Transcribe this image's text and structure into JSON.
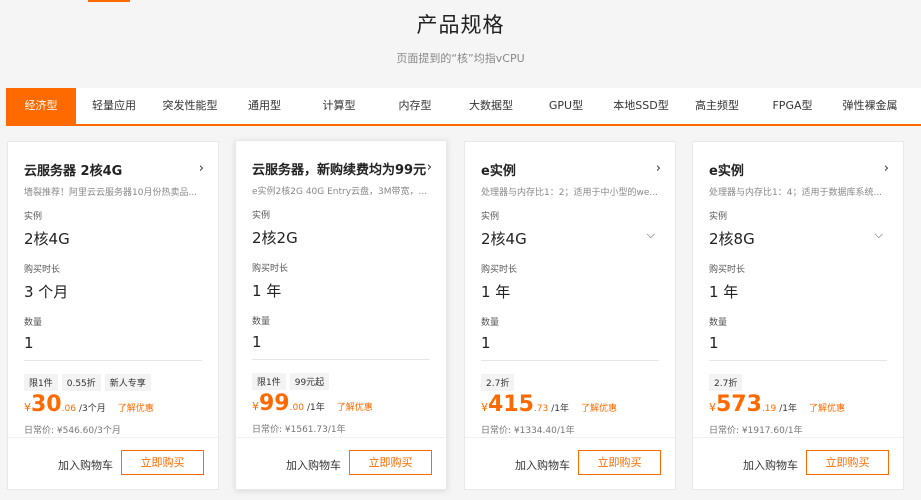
{
  "page": {
    "title": "产品规格",
    "subtitle": "页面提到的“核”均指vCPU"
  },
  "tabs": [
    "经济型",
    "轻量应用",
    "突发性能型",
    "通用型",
    "计算型",
    "内存型",
    "大数据型",
    "GPU型",
    "本地SSD型",
    "高主频型",
    "FPGA型",
    "弹性裸金属"
  ],
  "active_tab": "经济型",
  "labels": {
    "instance": "实例",
    "duration": "购买时长",
    "quantity": "数量",
    "add_to_cart": "加入购物车",
    "buy_now": "立即购买",
    "learn_promo": "了解优惠",
    "currency": "¥"
  },
  "cards": [
    {
      "title": "云服务器 2核4G",
      "desc": "墙裂推荐！阿里云云服务器10月份热卖品...",
      "instance": "2核4G",
      "duration": "3 个月",
      "quantity": "1",
      "tags": [
        "限1件",
        "0.55折",
        "新人专享"
      ],
      "price_int": "30",
      "price_dec": ".06",
      "unit": "/3个月",
      "original": "日常价: ¥546.60/3个月"
    },
    {
      "title": "云服务器，新购续费均为99元",
      "desc": "e实例2核2G 40G Entry云盘，3M带宽，...",
      "instance": "2核2G",
      "duration": "1 年",
      "quantity": "1",
      "tags": [
        "限1件",
        "99元起"
      ],
      "price_int": "99",
      "price_dec": ".00",
      "unit": "/1年",
      "original": "日常价: ¥1561.73/1年"
    },
    {
      "title": "e实例",
      "desc": "处理器与内存比1：2；适用于中小型的we...",
      "instance": "2核4G",
      "duration": "1 年",
      "quantity": "1",
      "tags": [
        "2.7折"
      ],
      "price_int": "415",
      "price_dec": ".73",
      "unit": "/1年",
      "original": "日常价: ¥1334.40/1年"
    },
    {
      "title": "e实例",
      "desc": "处理器与内存比1：4；适用于数据库系统...",
      "instance": "2核8G",
      "duration": "1 年",
      "quantity": "1",
      "tags": [
        "2.7折"
      ],
      "price_int": "573",
      "price_dec": ".19",
      "unit": "/1年",
      "original": "日常价: ¥1917.60/1年"
    }
  ],
  "colors": {
    "accent": "#ff6a00"
  }
}
